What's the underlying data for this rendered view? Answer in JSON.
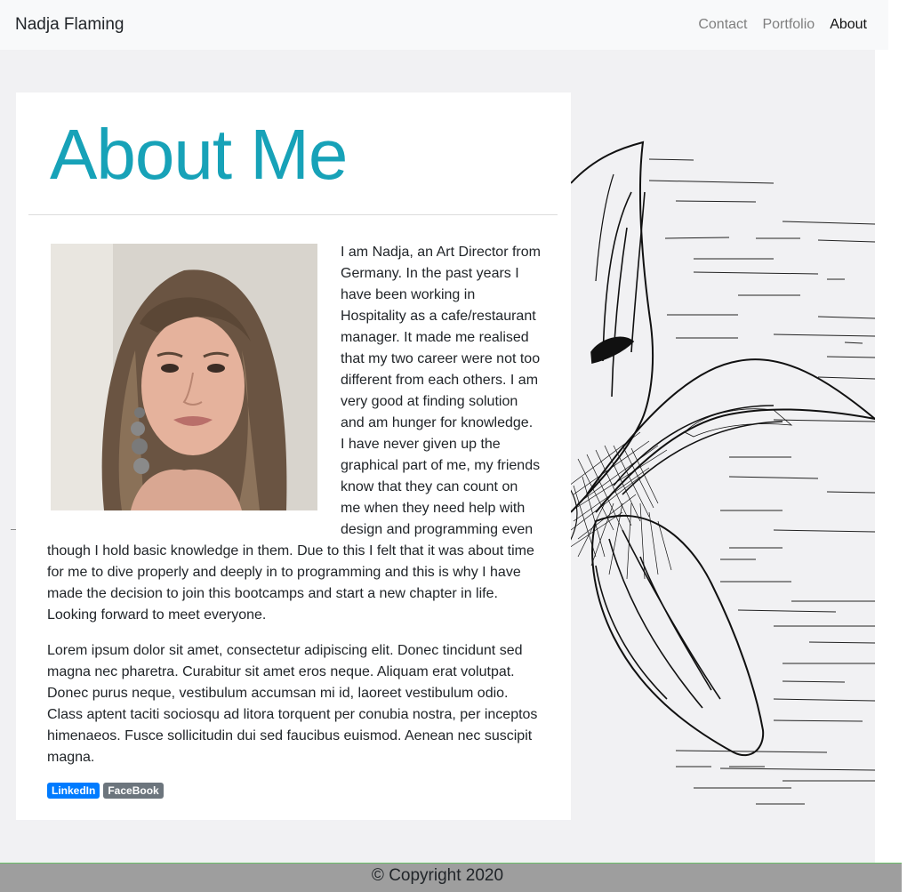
{
  "navbar": {
    "brand": "Nadja Flaming",
    "links": [
      {
        "label": "Contact"
      },
      {
        "label": "Portfolio"
      },
      {
        "label": "About"
      }
    ]
  },
  "card": {
    "title": "About Me",
    "paragraph1": "I am Nadja, an Art Director from Germany. In the past years I have been working in Hospitality as a cafe/restaurant manager. It made me realised that my two career were not too different from each others. I am very good at finding solution and am hunger for knowledge. I have never given up the graphical part of me, my friends know that they can count on me when they need help with design and programming even though I hold basic knowledge in them. Due to this I felt that it was about time for me to dive properly and deeply in to programming and this is why I have made the decision to join this bootcamps and start a new chapter in life. Looking forward to meet everyone.",
    "paragraph2": "Lorem ipsum dolor sit amet, consectetur adipiscing elit. Donec tincidunt sed magna nec pharetra. Curabitur sit amet eros neque. Aliquam erat volutpat. Donec purus neque, vestibulum accumsan mi id, laoreet vestibulum odio. Class aptent taciti sociosqu ad litora torquent per conubia nostra, per inceptos himenaeos. Fusce sollicitudin dui sed faucibus euismod. Aenean nec suscipit magna.",
    "badges": [
      {
        "label": "LinkedIn",
        "color": "#007bff"
      },
      {
        "label": "FaceBook",
        "color": "#6c757d"
      }
    ]
  },
  "footer": {
    "copyright": "© Copyright 2020"
  },
  "colors": {
    "title": "#17a2b8",
    "navbar_bg": "#f8f9fa",
    "page_bg": "#f1f1f3",
    "footer_bg": "#9e9e9e"
  }
}
